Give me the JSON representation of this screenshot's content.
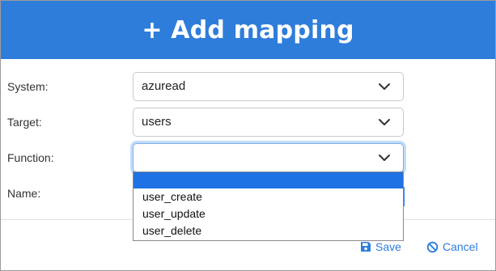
{
  "dialog": {
    "title": "+ Add mapping"
  },
  "form": {
    "system": {
      "label": "System:",
      "value": "azuread"
    },
    "target": {
      "label": "Target:",
      "value": "users"
    },
    "function": {
      "label": "Function:",
      "value": ""
    },
    "name": {
      "label": "Name:"
    }
  },
  "function_dropdown": {
    "options": [
      "",
      "user_create",
      "user_update",
      "user_delete"
    ],
    "highlighted_index": 0
  },
  "footer": {
    "save_label": "Save",
    "cancel_label": "Cancel"
  },
  "colors": {
    "header": "#2e7ddb",
    "accent": "#2e7ddb",
    "highlight": "#1e72e3"
  },
  "icons": {
    "save": "floppy-disk-icon",
    "cancel": "ban-icon",
    "dropdown": "chevron-down-icon"
  }
}
